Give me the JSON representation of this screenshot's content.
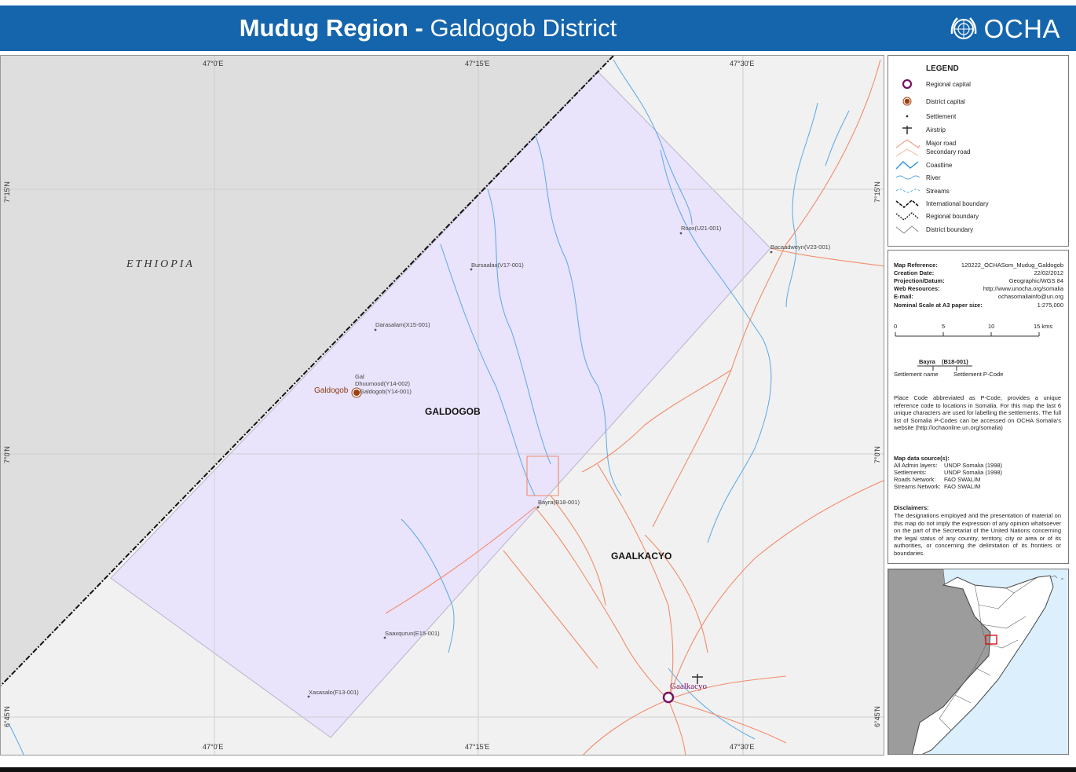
{
  "header": {
    "title_region": "Mudug Region",
    "title_sep": " - ",
    "title_district": "Galdogob District",
    "org": "OCHA",
    "bg_color": "#1565ad"
  },
  "map": {
    "ticks_top": [
      "47°0'E",
      "47°15'E",
      "47°30'E"
    ],
    "ticks_bottom": [
      "47°0'E",
      "47°15'E",
      "47°30'E"
    ],
    "ticks_left": [
      "7°15'N",
      "7°0'N",
      "6°45'N"
    ],
    "ticks_right": [
      "7°15'N",
      "7°0'N",
      "6°45'N"
    ],
    "country_label": "ETHIOPIA",
    "districts": [
      "GALDOGOB",
      "GAALKACYO"
    ],
    "district_capital": "Galdogob",
    "regional_capital": "Gaalkacyo",
    "settlements": [
      "Roox(U21-001)",
      "Bacaadweyn(V23-001)",
      "Bursaalax(V17-001)",
      "Darasalam(X15-001)",
      "Gal",
      "Dhuumood(Y14-002)",
      "Galdogob(Y14-001)",
      "Bayra(B18-001)",
      "Saaxqurun(E15-001)",
      "Xasasalo(F13-001)"
    ],
    "colors": {
      "district_fill": "#e9e3fc",
      "ethiopia_fill": "#dedede",
      "road": "#f28c6b",
      "river": "#5aa8e6",
      "capital": "#7a1060",
      "district_capital": "#a0400d"
    }
  },
  "legend": {
    "title": "LEGEND",
    "items": [
      {
        "label": "Regional capital",
        "icon": "regional-capital-icon"
      },
      {
        "label": "District capital",
        "icon": "district-capital-icon"
      },
      {
        "label": "Settlement",
        "icon": "settlement-icon"
      },
      {
        "label": "Airstrip",
        "icon": "airstrip-icon"
      },
      {
        "label": "Major road",
        "icon": "major-road-icon"
      },
      {
        "label": "Secondary road",
        "icon": "secondary-road-icon"
      },
      {
        "label": "Coastline",
        "icon": "coastline-icon"
      },
      {
        "label": "River",
        "icon": "river-icon"
      },
      {
        "label": "Streams",
        "icon": "streams-icon"
      },
      {
        "label": "International boundary",
        "icon": "international-boundary-icon"
      },
      {
        "label": "Regional boundary",
        "icon": "regional-boundary-icon"
      },
      {
        "label": "District boundary",
        "icon": "district-boundary-icon"
      }
    ]
  },
  "info": {
    "map_reference_label": "Map Reference:",
    "map_reference": "120222_OCHASom_Mudug_Galdogob",
    "creation_date_label": "Creation Date:",
    "creation_date": "22/02/2012",
    "projection_label": "Projection/Datum:",
    "projection": "Geographic/WGS 84",
    "web_label": "Web Resources:",
    "web": "http://www.unocha.org/somalia",
    "email_label": "E-mail:",
    "email": "ochasomaliainfo@un.org",
    "scale_label": "Nominal Scale at A3 paper size:",
    "scale": "1:275,000",
    "scalebar": [
      "0",
      "5",
      "10",
      "15 kms"
    ],
    "pcode_example_name": "Bayra",
    "pcode_example_code": "(B18-001)",
    "pcode_name_caption": "Settlement name",
    "pcode_code_caption": "Settlement P-Code",
    "pcode_text": "Place Code abbreviated as P-Code, provides a unique reference code to locations in Somalia. For this map the last 6 unique characters are used for labelling the settlements. The full list of Somalia P-Codes can be accessed on OCHA Somalia's website (http://ochaonline.un.org/somalia)",
    "sources_title": "Map data source(s):",
    "sources": [
      {
        "k": "All Admin layers:",
        "v": "UNDP Somalia (1998)"
      },
      {
        "k": "Settlements:",
        "v": "UNDP Somalia (1998)"
      },
      {
        "k": "Roads Network:",
        "v": "FAO SWALIM"
      },
      {
        "k": "Streams Network:",
        "v": "FAO SWALIM"
      }
    ],
    "disclaimer_title": "Disclaimers:",
    "disclaimer_text": "The designations employed and the presentation of material on this map do not imply the expression of any opinion whatsoever on the part of the Secretariat of the United Nations concerning the legal status of any country, territory, city or area or of its authorities, or concerning the delimitation of its frontiers or boundaries."
  }
}
